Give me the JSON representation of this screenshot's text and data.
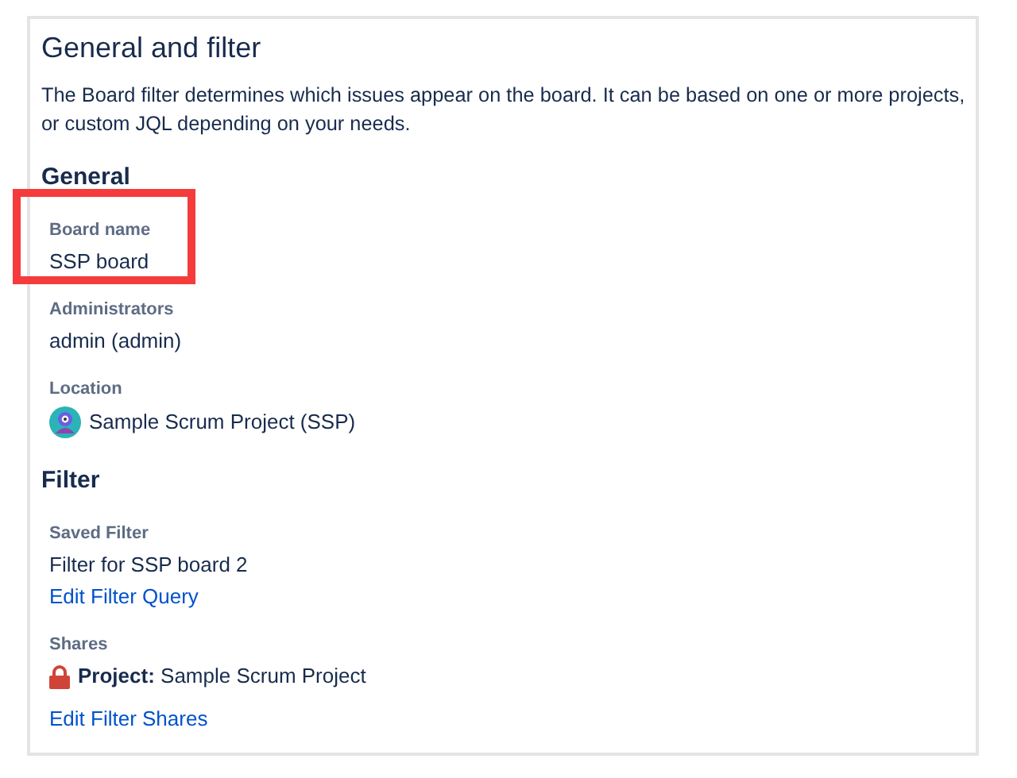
{
  "panel": {
    "title": "General and filter",
    "description": "The Board filter determines which issues appear on the board. It can be based on one or more projects, or custom JQL depending on your needs."
  },
  "sections": [
    {
      "heading": "General",
      "fields": [
        {
          "kind": "text",
          "label": "Board name",
          "value": "SSP board",
          "highlighted": true
        },
        {
          "kind": "text",
          "label": "Administrators",
          "value": "admin (admin)",
          "highlighted": false
        },
        {
          "kind": "project",
          "label": "Location",
          "value": "Sample Scrum Project (SSP)",
          "highlighted": false
        }
      ]
    },
    {
      "heading": "Filter",
      "fields": [
        {
          "kind": "text",
          "label": "Saved Filter",
          "value": "Filter for SSP board 2",
          "link": "Edit Filter Query",
          "highlighted": false
        },
        {
          "kind": "share",
          "label": "Shares",
          "value": "**Project:** Sample Scrum Project",
          "link": "Edit Filter Shares",
          "highlighted": false
        }
      ]
    }
  ]
}
